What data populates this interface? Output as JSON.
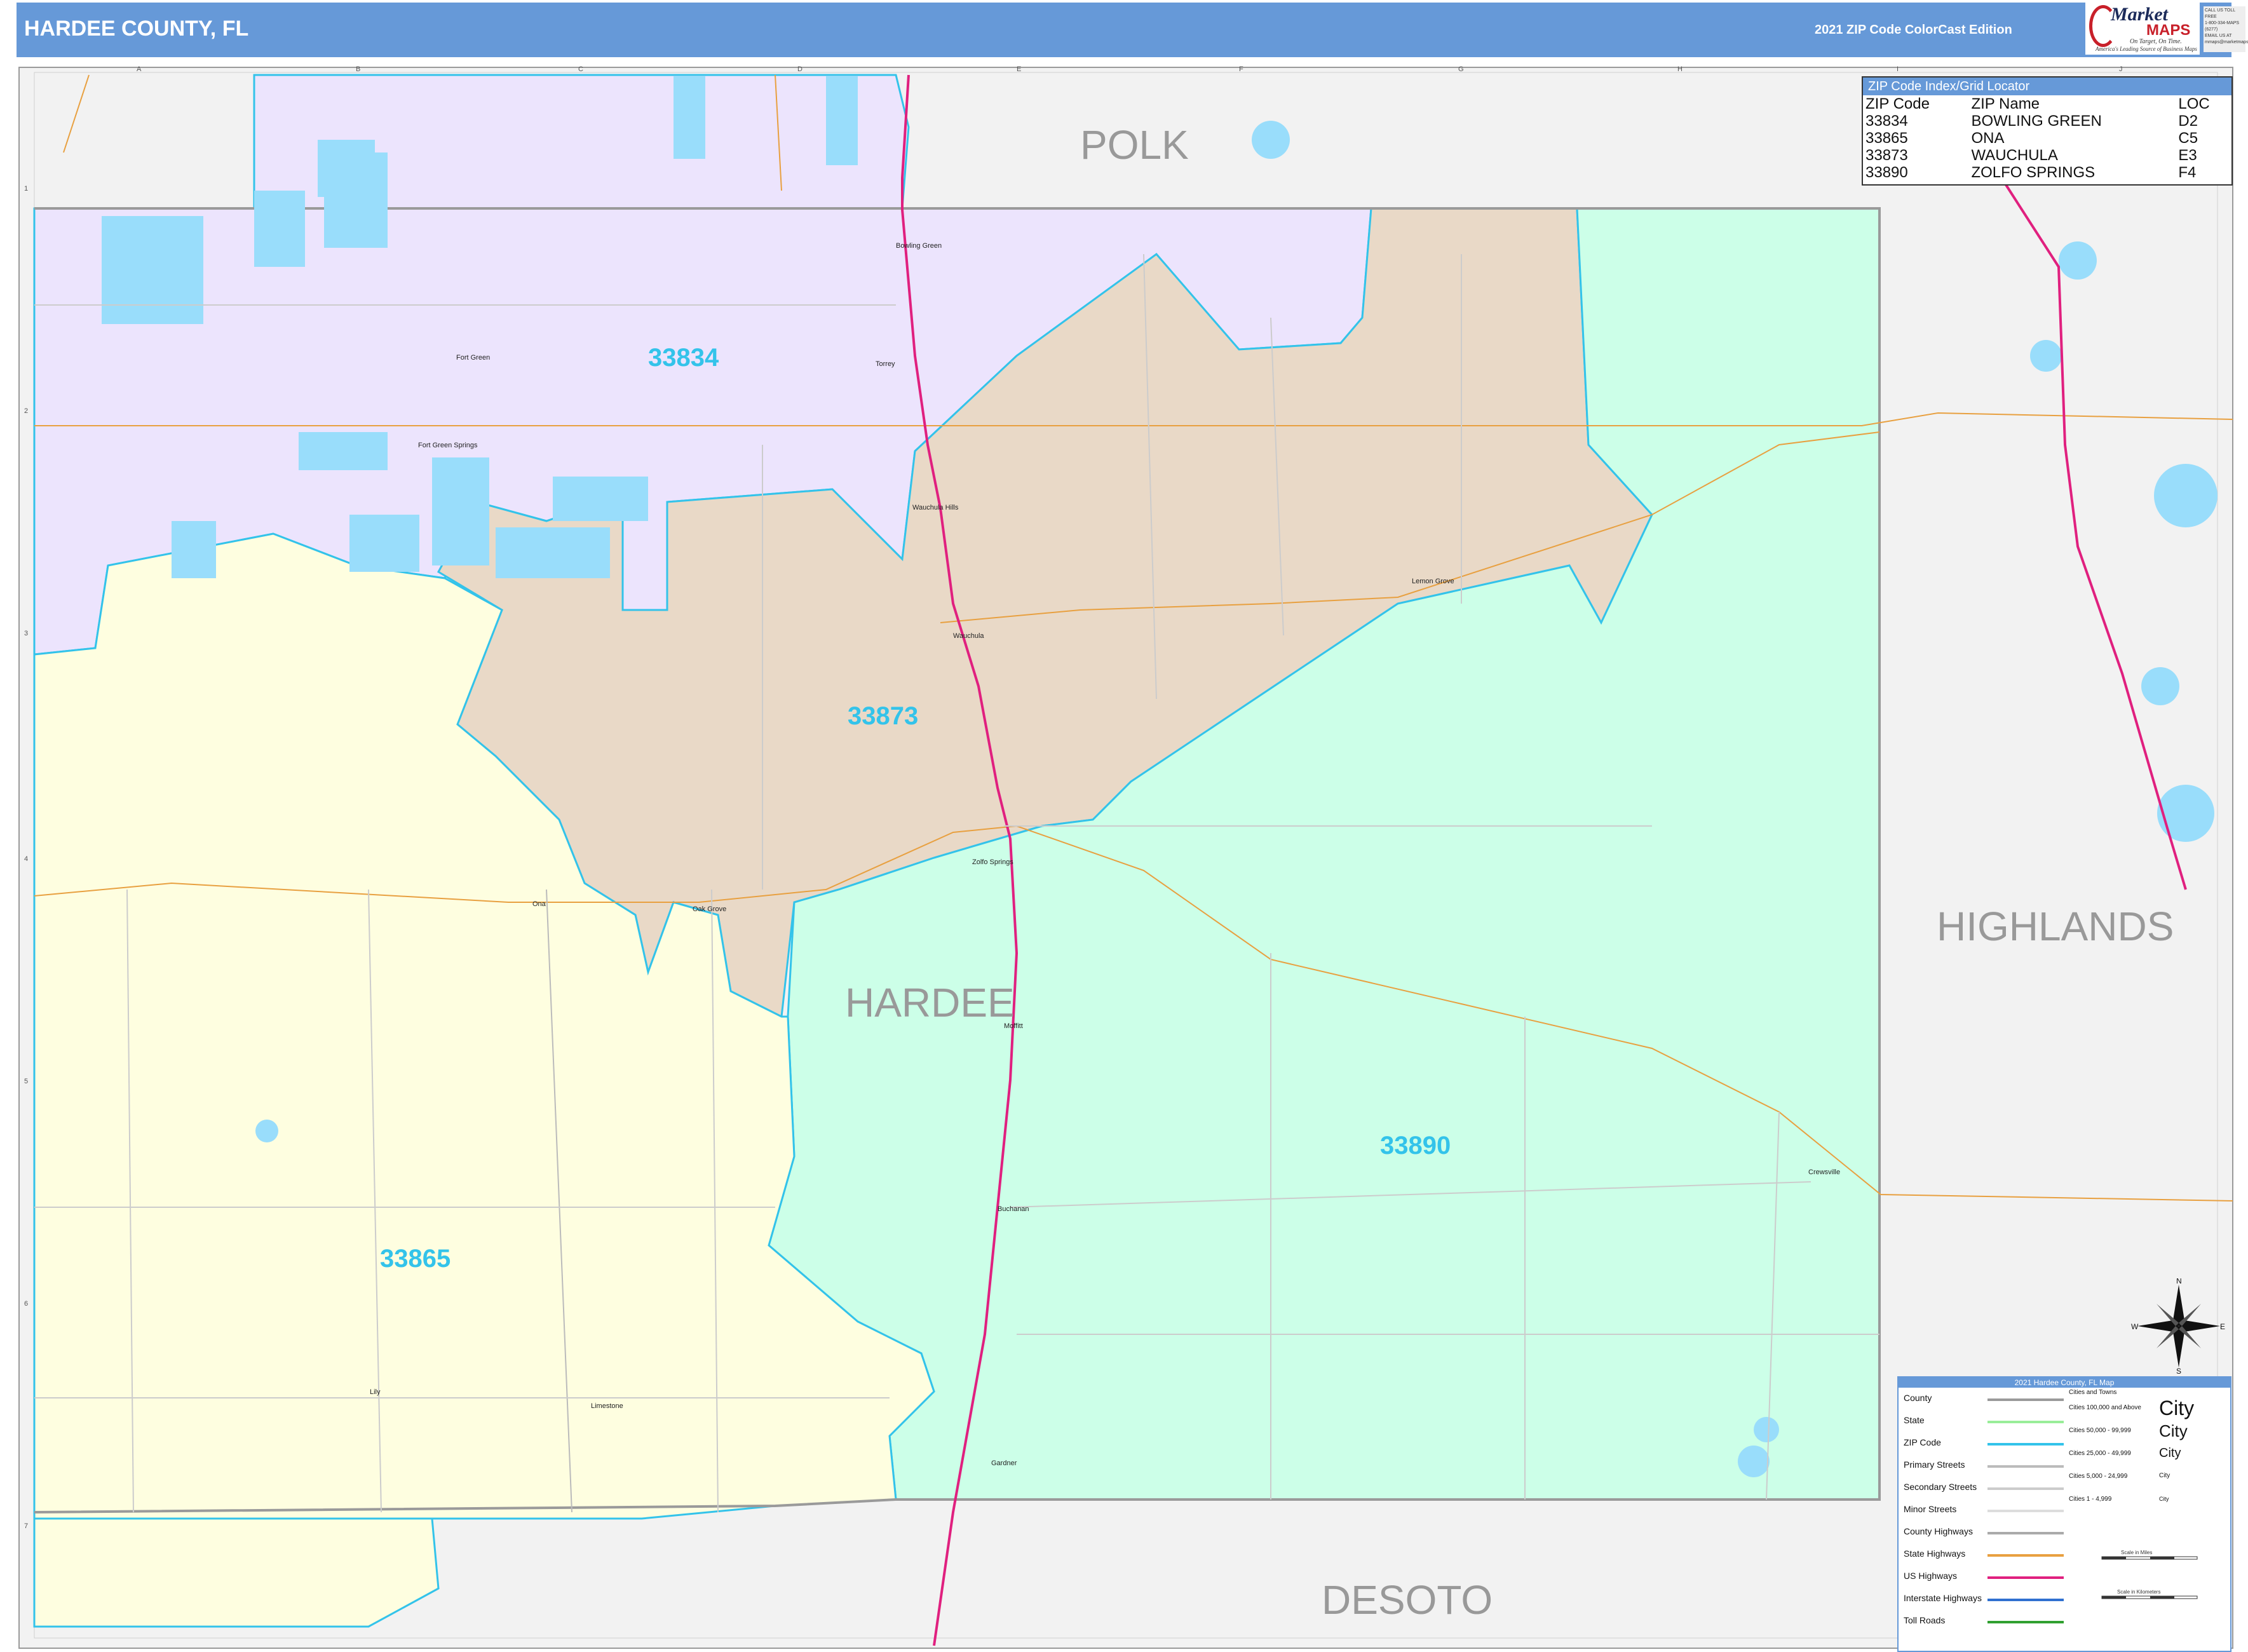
{
  "header": {
    "title": "HARDEE COUNTY, FL",
    "edition": "2021 ZIP Code ColorCast Edition",
    "logo": {
      "word1": "Market",
      "word2": "MAPS",
      "tagline1": "On Target, On Time.",
      "tagline2": "America's Leading Source of Business Maps"
    },
    "contact_lines": [
      "CALL US TOLL FREE",
      "1-800-334-MAPS (6277)",
      "EMAIL US AT",
      "mmaps@marketmaps.com"
    ]
  },
  "grid": {
    "columns": [
      "A",
      "B",
      "C",
      "D",
      "E",
      "F",
      "G",
      "H",
      "I",
      "J"
    ],
    "rows": [
      "1",
      "2",
      "3",
      "4",
      "5",
      "6",
      "7"
    ]
  },
  "counties": {
    "main": "HARDEE",
    "neighbors": [
      "POLK",
      "HIGHLANDS",
      "DESOTO"
    ]
  },
  "zip_areas": [
    {
      "zip": "33834",
      "name": "BOWLING GREEN",
      "color": "#ece4fd"
    },
    {
      "zip": "33873",
      "name": "WAUCHULA",
      "color": "#e9d9c7"
    },
    {
      "zip": "33865",
      "name": "ONA",
      "color": "#fefee0"
    },
    {
      "zip": "33890",
      "name": "ZOLFO SPRINGS",
      "color": "#ccffe8"
    }
  ],
  "zip_label_color": "#33c3ea",
  "zip_index": {
    "title": "ZIP Code Index/Grid Locator",
    "headers": [
      "ZIP Code",
      "ZIP Name",
      "LOC"
    ],
    "rows": [
      [
        "33834",
        "BOWLING GREEN",
        "D2"
      ],
      [
        "33865",
        "ONA",
        "C5"
      ],
      [
        "33873",
        "WAUCHULA",
        "E3"
      ],
      [
        "33890",
        "ZOLFO SPRINGS",
        "F4"
      ]
    ]
  },
  "places": [
    "Bowling Green",
    "Torrey",
    "Fort Green",
    "Fort Green Springs",
    "Wauchula Hills",
    "Wauchula",
    "Lemon Grove",
    "Zolfo Springs",
    "Ona",
    "Oak Grove",
    "Moffitt",
    "Buchanan",
    "Crewsville",
    "Lily",
    "Limestone",
    "Gardner"
  ],
  "legend": {
    "title": "2021 Hardee County, FL Map",
    "items": [
      {
        "label": "County",
        "color": "#9a9a9a"
      },
      {
        "label": "State",
        "color": "#99ee99"
      },
      {
        "label": "ZIP Code",
        "color": "#33c3ea"
      },
      {
        "label": "Primary Streets",
        "color": "#bbbbbb"
      },
      {
        "label": "Secondary Streets",
        "color": "#cccccc"
      },
      {
        "label": "Minor Streets",
        "color": "#dddddd"
      },
      {
        "label": "County Highways",
        "color": "#aaaaaa"
      },
      {
        "label": "State Highways",
        "color": "#e8a040"
      },
      {
        "label": "US Highways",
        "color": "#e0207f"
      },
      {
        "label": "Interstate Highways",
        "color": "#3070d0"
      },
      {
        "label": "Toll Roads",
        "color": "#30a030"
      }
    ],
    "cities_heading": "Cities and Towns",
    "cities": [
      {
        "label": "Cities 100,000 and Above",
        "sample": "City"
      },
      {
        "label": "Cities 50,000 - 99,999",
        "sample": "City"
      },
      {
        "label": "Cities 25,000 - 49,999",
        "sample": "City"
      },
      {
        "label": "Cities 5,000 - 24,999",
        "sample": "City"
      },
      {
        "label": "Cities 1 - 4,999",
        "sample": "City"
      }
    ],
    "scale_miles": "Scale in Miles",
    "scale_km": "Scale in Kilometers"
  },
  "compass_letters": [
    "N",
    "E",
    "S",
    "W"
  ],
  "colors": {
    "header": "#6699d8",
    "water": "#99ddfb",
    "outside": "#f2f2f2",
    "us_highway": "#e0207f",
    "state_highway": "#e8a040",
    "county_border": "#9a9a9a",
    "zip_border": "#33c3ea"
  }
}
